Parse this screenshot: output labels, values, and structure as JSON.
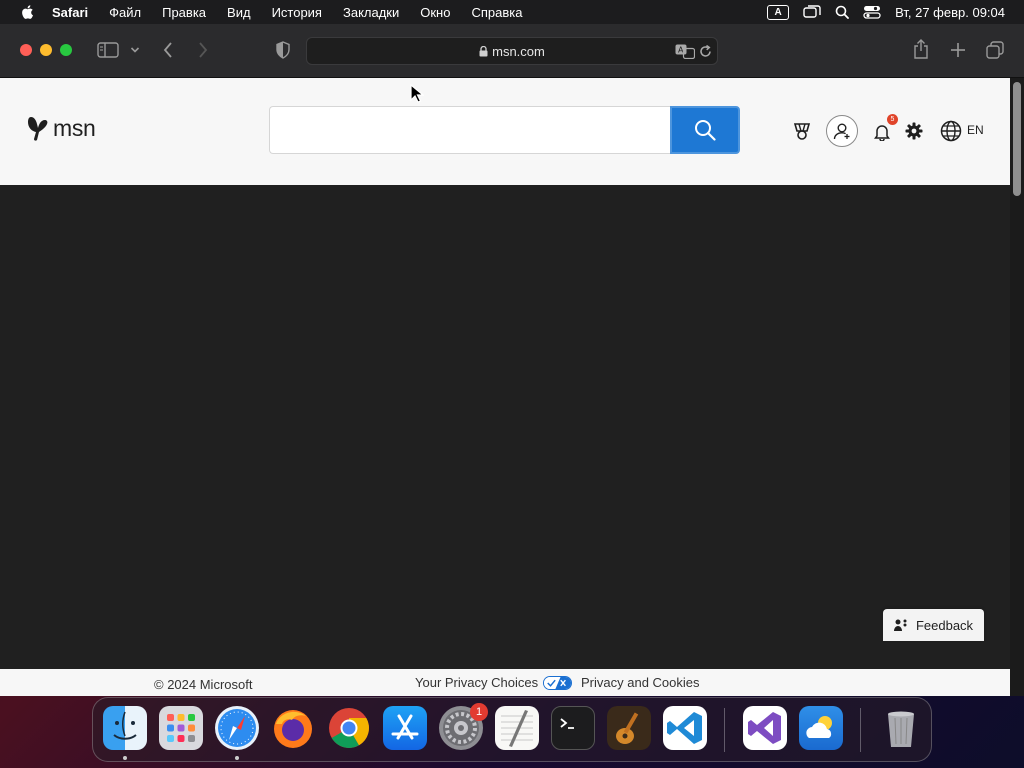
{
  "menubar": {
    "app_name": "Safari",
    "items": [
      "Файл",
      "Правка",
      "Вид",
      "История",
      "Закладки",
      "Окно",
      "Справка"
    ],
    "input_source": "A",
    "clock": "Вт, 27 февр.  09:04"
  },
  "browser": {
    "url": "msn.com"
  },
  "msn": {
    "logo_text": "msn",
    "search_placeholder": "",
    "notification_count": "5",
    "language": "EN",
    "colors": {
      "search_button": "#1e78d4",
      "header_bg": "#f7f7f7",
      "page_bg": "#202020"
    }
  },
  "footer": {
    "copyright": "© 2024 Microsoft",
    "privacy_choices": "Your Privacy Choices",
    "privacy_cookies": "Privacy and Cookies",
    "feedback": "Feedback"
  },
  "dock": {
    "apps": [
      "finder-icon",
      "launchpad-icon",
      "safari-icon",
      "firefox-icon",
      "chrome-icon",
      "app-store-icon",
      "system-settings-icon",
      "textedit-icon",
      "terminal-icon",
      "garageband-icon",
      "vscode-icon",
      "visual-studio-icon",
      "weather-icon",
      "trash-icon"
    ],
    "system_settings_badge": "1"
  }
}
